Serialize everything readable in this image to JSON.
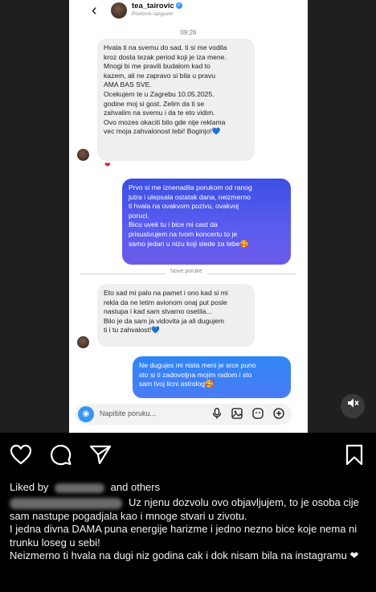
{
  "dm": {
    "username": "tea_tairovic",
    "subtitle": "Poslovni razgovor",
    "time": "09:26",
    "msg1": "Hvala ti na svemu do sad, ti si me vodila\nkroz dosta tezak period koji je iza mene.\nMnogi bi me pravili budalom kad to\nkazem, ali ne zapravo si bila u pravu\nAMA BAS SVE.\nOcekujem te u Zagrebu 10.05.2025.\ngodine moj si gost. Zelim da ti se\nzahvalim na svemu i da te eto vidim.\nOvo mozes okaciti bilo gde nije reklama\nvec moja zahvalonost tebi! Boginjo!💙",
    "msg2": "Prvo si me iznenadila porukom od ranog\njutra i ulepsala ostatak dana, neizmerno\nti hvala na ovakvom pozivu, ovakvoj\nporuci.\nBicu uvek tu i bice mi cast da\nprisustvujem na tvom koncertu to je\nsamo jedan u nizu koji slede za tebe🥰",
    "divider": "Nove poruke",
    "msg3": "Eto sad mi palo na pamet i ono kad si mi\nrekla da ne letim avionom onaj put posle\nnastupa i kad sam stvarno osetila...\nBilo je da sam ja vidovita ja ali dugujem\nti i tu zahvalost!💙",
    "msg4": "Ne dugujes mi nista meni je srce puno\nsto si ti zadovoljna mojim radom i sto\nsam tvoj licni astrolog🥰",
    "placeholder": "Napišite poruku...",
    "reaction": "❤"
  },
  "post": {
    "liked_prefix": "Liked by",
    "liked_suffix": "and others",
    "caption_1": "Uz njenu dozvolu ovo objavljujem, to je osoba cije sam nastupe pogadjala kao i mnoge stvari u zivotu.",
    "caption_2": "I jedna divna DAMA puna energije harizme i jedno nezno bice koje nema ni trunku loseg u sebi!",
    "caption_3": "Neizmerno ti hvala na dugi niz godina cak i dok nisam bila na instagramu ❤"
  },
  "icons": [
    "back-icon",
    "verified-icon",
    "camera-icon",
    "microphone-icon",
    "gallery-icon",
    "sticker-icon",
    "plus-icon",
    "mute-icon",
    "heart-icon",
    "comment-icon",
    "share-icon",
    "bookmark-icon"
  ],
  "colors": {
    "accent": "#3797f0",
    "bubble_in": "#efefef",
    "bubble_out": "#4f55ec",
    "background": "#000000"
  }
}
